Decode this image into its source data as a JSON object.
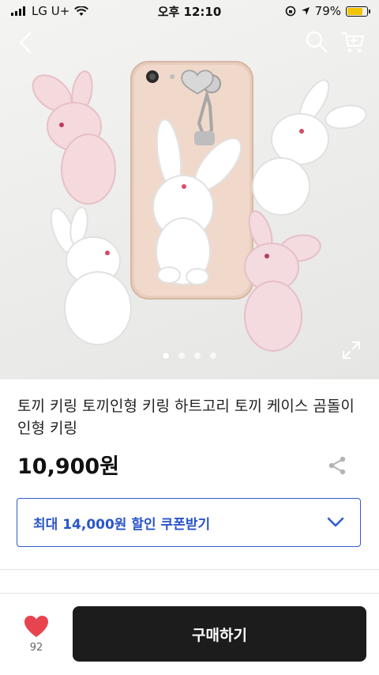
{
  "status_bar": {
    "carrier": "LG U+",
    "time": "오후 12:10",
    "battery": "79%",
    "battery_level": 0.79
  },
  "icons": {
    "back": "back-arrow-icon",
    "search": "search-icon",
    "cart": "cart-icon",
    "expand": "expand-icon",
    "share": "share-icon",
    "coupon_chevron": "chevron-down-icon",
    "like": "heart-icon"
  },
  "gallery": {
    "total_slides": 4,
    "active_slide": 1
  },
  "product": {
    "title": "토끼 키링 토끼인형 키링 하트고리 토끼 케이스 곰돌이 인형 키링",
    "price": "10,900원"
  },
  "coupon": {
    "label": "최대 14,000원 할인 쿠폰받기"
  },
  "bottom_bar": {
    "like_count": "92",
    "buy_label": "구매하기"
  },
  "colors": {
    "accent_blue": "#2f5bd3",
    "heart_red": "#e8444f",
    "buy_button": "#1c1c1c",
    "battery_yellow": "#f5c400"
  }
}
